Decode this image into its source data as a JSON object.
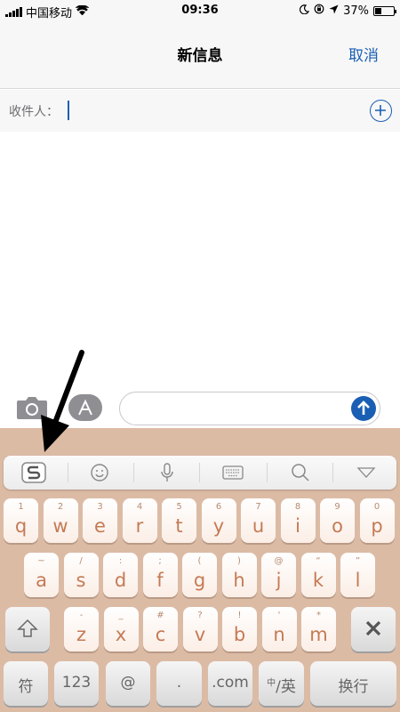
{
  "status_bar": {
    "carrier": "中国移动",
    "time": "09:36",
    "battery_percent": "37%",
    "battery_level": 0.37,
    "icons": [
      "signal-icon",
      "wifi-icon",
      "moon-icon",
      "rotation-lock-icon",
      "location-icon",
      "battery-icon"
    ]
  },
  "nav": {
    "title": "新信息",
    "cancel": "取消"
  },
  "recipient": {
    "label": "收件人：",
    "value": ""
  },
  "compose": {
    "message_value": "",
    "icons": [
      "camera-icon",
      "app-store-icon",
      "send-arrow-icon"
    ]
  },
  "keyboard": {
    "toolbar_icons": [
      "sogou-logo-icon",
      "emoji-icon",
      "microphone-icon",
      "keyboard-icon",
      "search-icon",
      "collapse-triangle-icon"
    ],
    "row1": [
      {
        "hint": "1",
        "key": "q"
      },
      {
        "hint": "2",
        "key": "w"
      },
      {
        "hint": "3",
        "key": "e"
      },
      {
        "hint": "4",
        "key": "r"
      },
      {
        "hint": "5",
        "key": "t"
      },
      {
        "hint": "6",
        "key": "y"
      },
      {
        "hint": "7",
        "key": "u"
      },
      {
        "hint": "8",
        "key": "i"
      },
      {
        "hint": "9",
        "key": "o"
      },
      {
        "hint": "0",
        "key": "p"
      }
    ],
    "row2": [
      {
        "hint": "~",
        "key": "a"
      },
      {
        "hint": "/",
        "key": "s"
      },
      {
        "hint": ":",
        "key": "d"
      },
      {
        "hint": ";",
        "key": "f"
      },
      {
        "hint": "(",
        "key": "g"
      },
      {
        "hint": ")",
        "key": "h"
      },
      {
        "hint": "@",
        "key": "j"
      },
      {
        "hint": "“",
        "key": "k"
      },
      {
        "hint": "”",
        "key": "l"
      }
    ],
    "row3": [
      {
        "hint": "-",
        "key": "z"
      },
      {
        "hint": "_",
        "key": "x"
      },
      {
        "hint": "#",
        "key": "c"
      },
      {
        "hint": "?",
        "key": "v"
      },
      {
        "hint": "!",
        "key": "b"
      },
      {
        "hint": "'",
        "key": "n"
      },
      {
        "hint": "*",
        "key": "m"
      }
    ],
    "bottom": {
      "symbols": "符",
      "numbers": "123",
      "at": "@",
      "dot": ".",
      "dotcom": ".com",
      "lang_small": "中",
      "lang": "/英",
      "return": "换行"
    }
  }
}
